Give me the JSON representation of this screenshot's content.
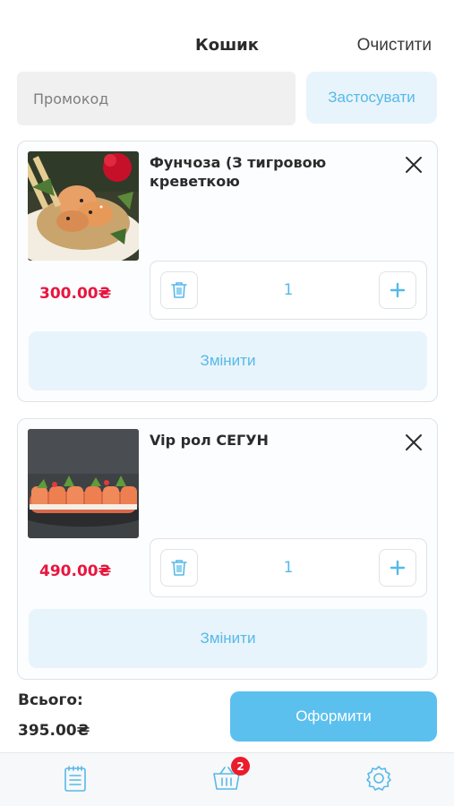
{
  "header": {
    "title": "Кошик",
    "clear_label": "Очистити"
  },
  "promo": {
    "placeholder": "Промокод",
    "apply_label": "Застосувати"
  },
  "items": [
    {
      "name": "Фунчоза  (З тигровою креветкою",
      "price": "300.00₴",
      "quantity": "1",
      "edit_label": "Змінити",
      "image_icon": "funchoza-shrimp-photo"
    },
    {
      "name": "Vip рол СЕГУН",
      "price": "490.00₴",
      "quantity": "1",
      "edit_label": "Змінити",
      "image_icon": "sushi-roll-photo"
    }
  ],
  "summary": {
    "total_label": "Всього:",
    "total_value": "395.00₴",
    "checkout_label": "Оформити"
  },
  "tabbar": {
    "cart_badge": "2",
    "tabs": [
      "menu-icon",
      "cart-icon",
      "settings-icon"
    ]
  },
  "colors": {
    "accent": "#56b9e9",
    "accent_light": "#e8f4fb",
    "price": "#e8163f",
    "badge": "#ea1c2b",
    "checkout": "#5cc0ee"
  }
}
